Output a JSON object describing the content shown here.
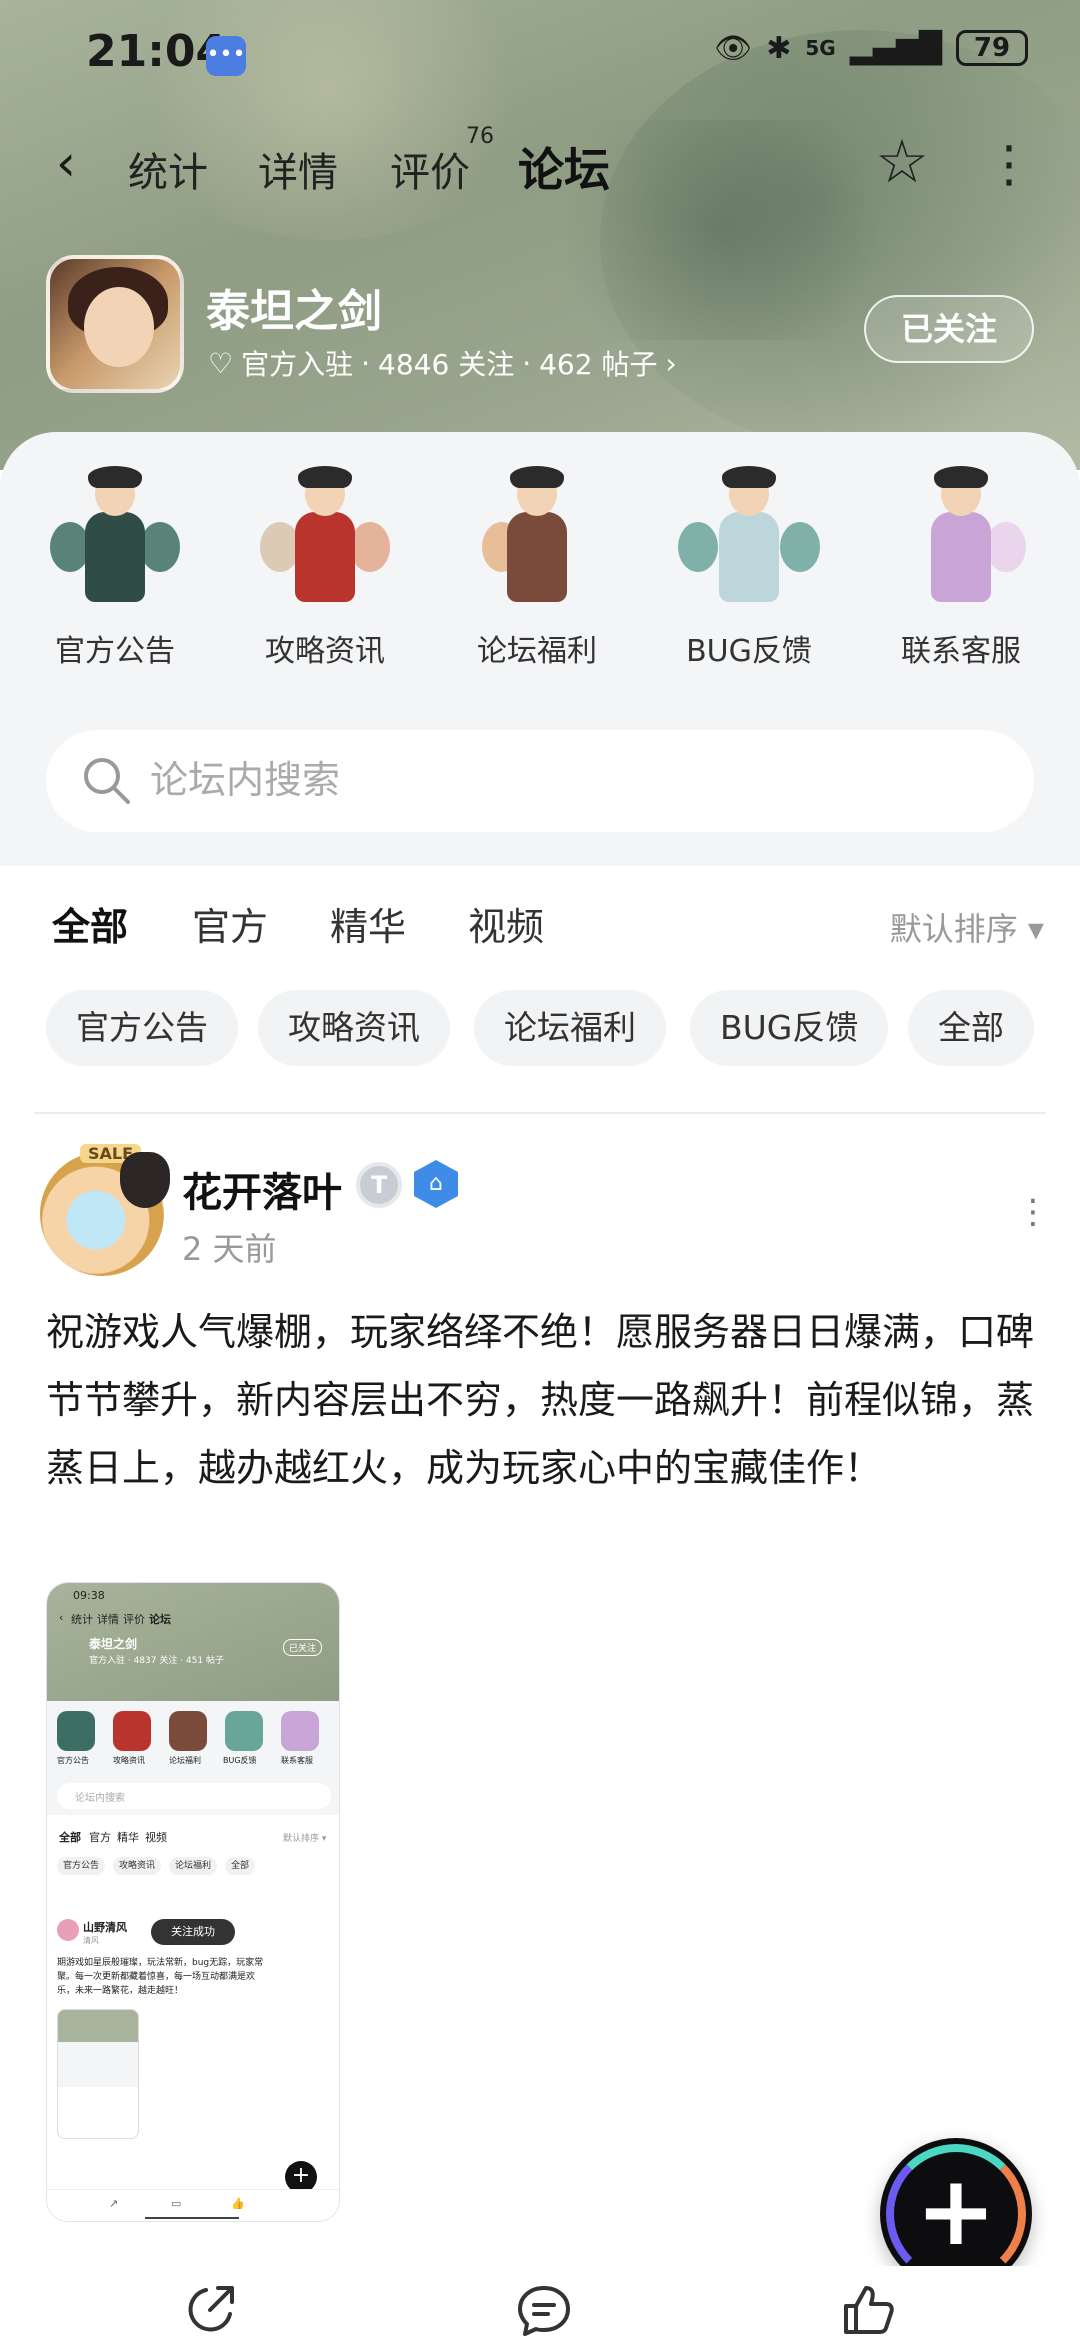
{
  "status_bar": {
    "time": "21:04",
    "network": "5G",
    "battery": "79"
  },
  "nav": {
    "tabs": [
      {
        "label": "统计"
      },
      {
        "label": "详情"
      },
      {
        "label": "评价",
        "badge": "76"
      },
      {
        "label": "论坛",
        "active": true
      }
    ]
  },
  "game": {
    "name": "泰坦之剑",
    "meta_official": "官方入驻",
    "meta_follows": "4846 关注",
    "meta_posts": "462 帖子",
    "meta_sep": "·",
    "follow_button": "已关注"
  },
  "categories": [
    {
      "label": "官方公告",
      "color": "#3d6e63"
    },
    {
      "label": "攻略资讯",
      "color": "#b8342c"
    },
    {
      "label": "论坛福利",
      "color": "#7a4a3a"
    },
    {
      "label": "BUG反馈",
      "color": "#6aa59a"
    },
    {
      "label": "联系客服",
      "color": "#c9a4d6"
    }
  ],
  "search": {
    "placeholder": "论坛内搜索"
  },
  "feed_tabs": [
    {
      "label": "全部",
      "active": true
    },
    {
      "label": "官方"
    },
    {
      "label": "精华"
    },
    {
      "label": "视频"
    }
  ],
  "sort": {
    "label": "默认排序 ▾"
  },
  "chips": [
    "官方公告",
    "攻略资讯",
    "论坛福利",
    "BUG反馈",
    "全部"
  ],
  "post": {
    "author": "花开落叶",
    "avatar_badge": "SALE",
    "time": "2 天前",
    "text": "祝游戏人气爆棚，玩家络绎不绝！愿服务器日日爆满，口碑节节攀升，新内容层出不穷，热度一路飙升！前程似锦，蒸蒸日上，越办越红火，成为玩家心中的宝藏佳作！",
    "image": {
      "time": "09:38",
      "tabs": [
        "统计",
        "详情",
        "评价",
        "论坛"
      ],
      "game": "泰坦之剑",
      "meta": "官方入驻 · 4837 关注 · 451 帖子",
      "follow": "已关注",
      "categories": [
        "官方公告",
        "攻略资讯",
        "论坛福利",
        "BUG反馈",
        "联系客服"
      ],
      "search": "论坛内搜索",
      "feed_tabs": [
        "全部",
        "官方",
        "精华",
        "视频"
      ],
      "sort": "默认排序 ▾",
      "chips": [
        "官方公告",
        "攻略资讯",
        "论坛福利",
        "全部"
      ],
      "author": "山野清风",
      "author_sub": "清风",
      "toast": "关注成功",
      "text_lines": [
        "期游戏如星辰般璀璨，玩法常新，bug无踪，玩家常",
        "聚。每一次更新都藏着惊喜，每一场互动都满是欢",
        "乐，未来一路繁花，越走越旺！"
      ]
    }
  },
  "accent_color": "#50e6c8"
}
